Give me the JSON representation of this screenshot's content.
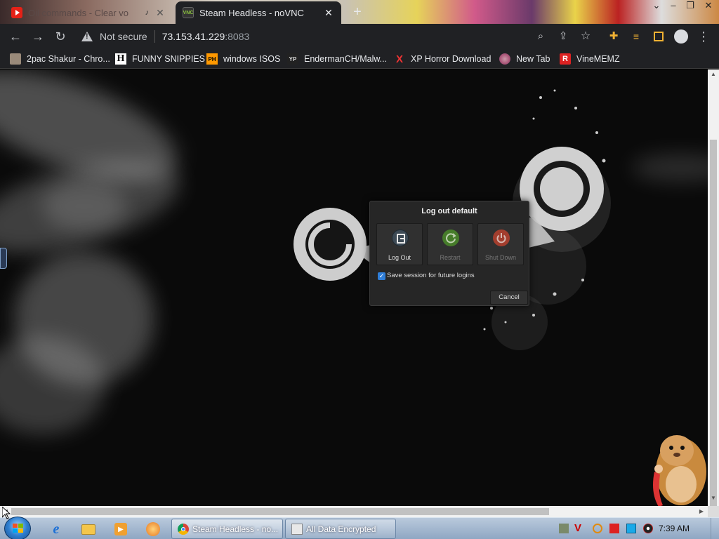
{
  "browser": {
    "tabs": [
      {
        "title": "Oil commands - Clear vo",
        "active": false,
        "favicon": "youtube-icon",
        "audio": true
      },
      {
        "title": "Steam Headless - noVNC",
        "active": true,
        "favicon": "novnc-icon",
        "favicon_text": "VNC"
      }
    ],
    "address": {
      "security_label": "Not secure",
      "host": "73.153.41.229",
      "port": ":8083"
    },
    "bookmarks": [
      {
        "label": "2pac Shakur - Chro...",
        "icon": "image-icon"
      },
      {
        "label": "FUNNY SNIPPIES",
        "icon": "h-icon",
        "icon_text": "H"
      },
      {
        "label": "windows ISOS",
        "icon": "ph-icon",
        "icon_text": "PH"
      },
      {
        "label": "EndermanCH/Malw...",
        "icon": "yp-icon",
        "icon_text": "YP"
      },
      {
        "label": "XP Horror Download",
        "icon": "x-icon",
        "icon_text": "X"
      },
      {
        "label": "New Tab",
        "icon": "globe-icon"
      },
      {
        "label": "VineMEMZ",
        "icon": "r-icon",
        "icon_text": "R"
      }
    ]
  },
  "dialog": {
    "title": "Log out default",
    "buttons": [
      {
        "label": "Log Out",
        "icon": "logout-icon",
        "enabled": true
      },
      {
        "label": "Restart",
        "icon": "restart-icon",
        "enabled": false
      },
      {
        "label": "Shut Down",
        "icon": "power-icon",
        "enabled": false
      }
    ],
    "save_session": {
      "label": "Save session for future logins",
      "checked": true
    },
    "cancel_label": "Cancel"
  },
  "taskbar": {
    "pinned": [
      "internet-explorer-icon",
      "explorer-folder-icon",
      "media-player-icon",
      "app-icon"
    ],
    "tasks": [
      {
        "label": "Steam Headless - no...",
        "icon": "chrome-icon",
        "active": true
      },
      {
        "label": "All Data Encrypted",
        "icon": "window-icon",
        "active": false
      }
    ],
    "clock": "7:39 AM"
  },
  "colors": {
    "chrome_dark": "#202124",
    "dialog_bg": "#262626",
    "checkbox_blue": "#2f7ed8",
    "restart_green": "#4a8a2a",
    "shutdown_red": "#b8412e"
  }
}
